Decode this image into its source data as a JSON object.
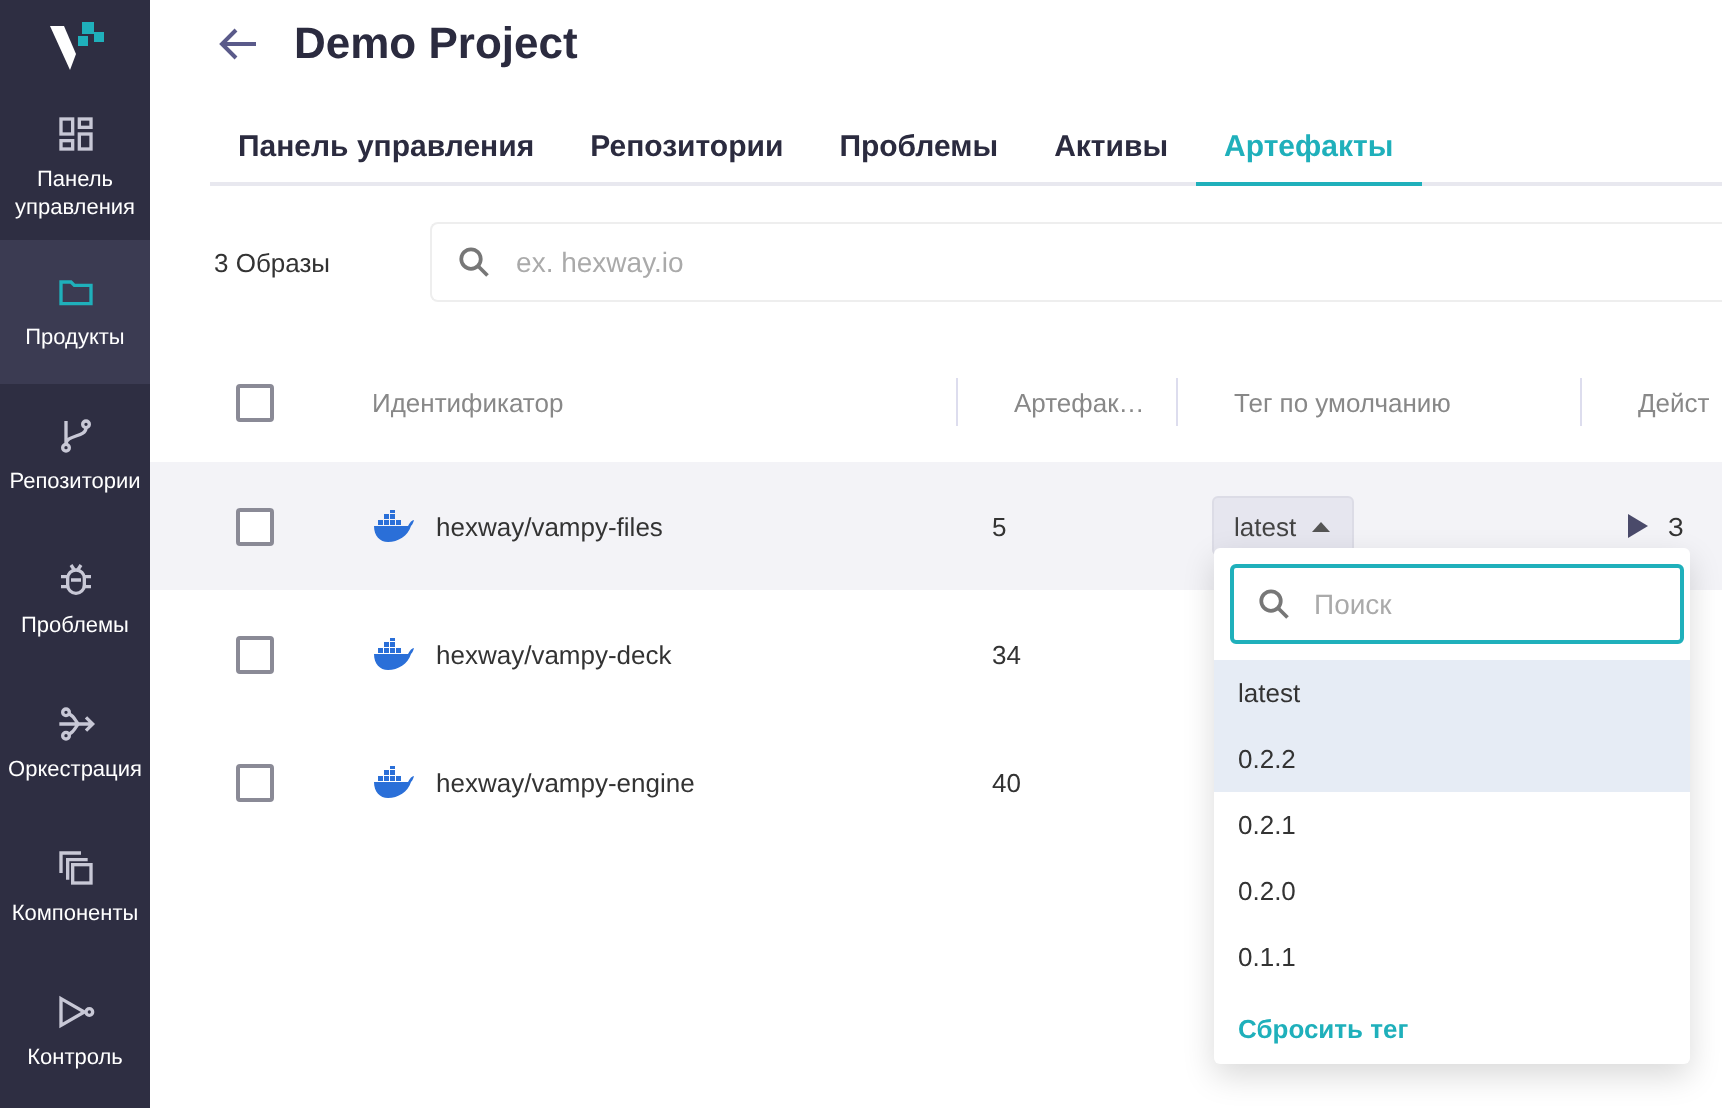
{
  "sidebar": {
    "items": [
      {
        "kind": "dashboard",
        "label": "Панель управления",
        "selected": false
      },
      {
        "kind": "folder",
        "label": "Продукты",
        "selected": true
      },
      {
        "kind": "branch",
        "label": "Репозитории",
        "selected": false
      },
      {
        "kind": "bug",
        "label": "Проблемы",
        "selected": false
      },
      {
        "kind": "flow",
        "label": "Оркестрация",
        "selected": false
      },
      {
        "kind": "copies",
        "label": "Компоненты",
        "selected": false
      },
      {
        "kind": "control",
        "label": "Контроль",
        "selected": false
      }
    ]
  },
  "header": {
    "title": "Demo Project"
  },
  "tabs": [
    {
      "label": "Панель управления",
      "selected": false
    },
    {
      "label": "Репозитории",
      "selected": false
    },
    {
      "label": "Проблемы",
      "selected": false
    },
    {
      "label": "Активы",
      "selected": false
    },
    {
      "label": "Артефакты",
      "selected": true
    }
  ],
  "toolbar": {
    "count": "3 Образы",
    "search": {
      "placeholder": "ex. hexway.io"
    }
  },
  "table": {
    "all_checked": false,
    "columns": [
      "Идентификатор",
      "Артефак…",
      "Тег по умолчанию",
      "Дейст"
    ],
    "rows": [
      {
        "checked": false,
        "highlighted": true,
        "name": "hexway/vampy-files",
        "artifacts": "5",
        "tag": "latest",
        "action": "З"
      },
      {
        "checked": false,
        "highlighted": false,
        "name": "hexway/vampy-deck",
        "artifacts": "34"
      },
      {
        "checked": false,
        "highlighted": false,
        "name": "hexway/vampy-engine",
        "artifacts": "40"
      }
    ]
  },
  "tag_menu": {
    "search": {
      "placeholder": "Поиск"
    },
    "options": [
      {
        "label": "latest",
        "highlighted": true
      },
      {
        "label": "0.2.2",
        "highlighted": true
      },
      {
        "label": "0.2.1",
        "highlighted": false
      },
      {
        "label": "0.2.0",
        "highlighted": false
      },
      {
        "label": "0.1.1",
        "highlighted": false
      }
    ],
    "reset": "Сбросить тег"
  }
}
